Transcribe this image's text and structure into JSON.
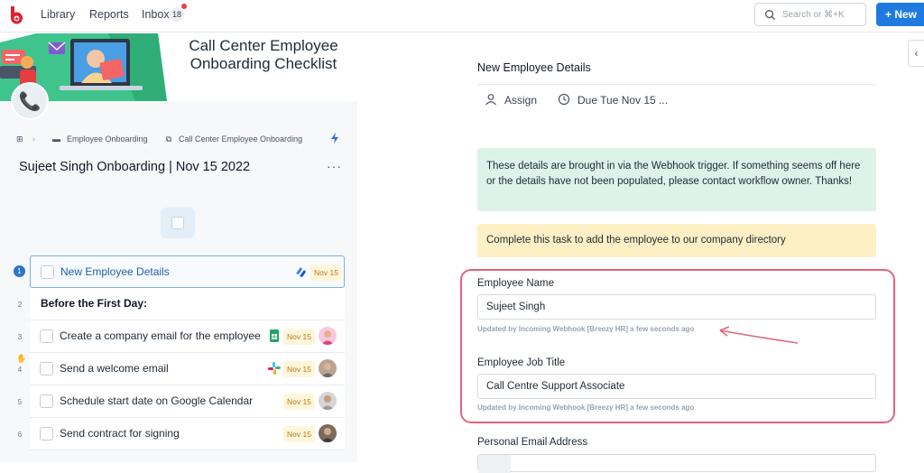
{
  "topbar": {
    "nav": [
      {
        "label": "Library"
      },
      {
        "label": "Reports"
      },
      {
        "label": "Inbox"
      }
    ],
    "inbox_count": "18",
    "search_placeholder": "Search or ⌘+K",
    "new_label": "+ New",
    "logo_color": "#e0202e",
    "accent": "#1f7ae0"
  },
  "left": {
    "banner_title_line1": "Call Center Employee",
    "banner_title_line2": "Onboarding Checklist",
    "breadcrumb": {
      "folder": "Employee Onboarding",
      "workflow": "Call Center Employee Onboarding"
    },
    "run_title": "Sujeet Singh Onboarding | Nov 15 2022",
    "more_label": "···",
    "steps": [
      {
        "num": "1",
        "label": "New Employee Details",
        "due": "Nov 15",
        "app": "webhook-icon",
        "active": true
      },
      {
        "num": "2",
        "label": "Before the First Day:",
        "heading": true
      },
      {
        "num": "3",
        "label": "Create a company email for the employee",
        "due": "Nov 15",
        "app": "google-sheets-icon"
      },
      {
        "num": "4",
        "label": "Send a welcome email",
        "due": "Nov 15",
        "app": "slack-icon"
      },
      {
        "num": "5",
        "label": "Schedule start date on Google Calendar",
        "due": "Nov 15"
      },
      {
        "num": "6",
        "label": "Send contract for signing",
        "due": "Nov 15"
      }
    ]
  },
  "right": {
    "task_title": "New Employee Details",
    "assign_label": "Assign",
    "due_label": "Due Tue Nov 15 ...",
    "info_green": "These details are brought in via the Webhook trigger. If something seems off here or the details have not been populated, please contact workflow owner. Thanks!",
    "info_yellow": "Complete this task to add the employee to our company directory",
    "fields": [
      {
        "label": "Employee Name",
        "value": "Sujeet Singh",
        "note": "Updated by Incoming Webhook [Breezy HR] a few seconds ago"
      },
      {
        "label": "Employee Job Title",
        "value": "Call Centre Support Associate",
        "note": "Updated by Incoming Webhook [Breezy HR] a few seconds ago"
      },
      {
        "label": "Personal Email Address",
        "value": ""
      }
    ],
    "highlight_color": "#e4637b"
  }
}
